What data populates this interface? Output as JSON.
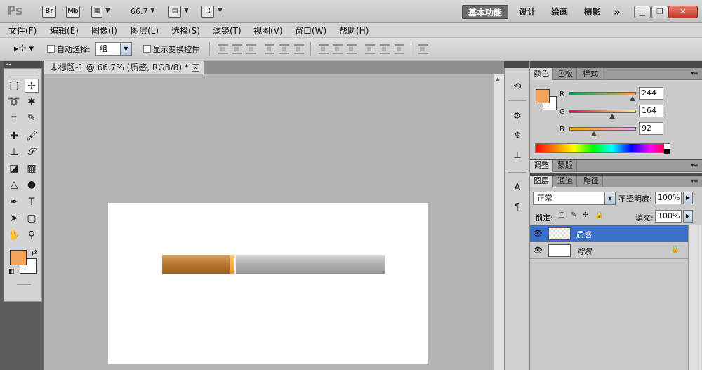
{
  "titlebar": {
    "logo": "Ps",
    "br": "Br",
    "mb": "Mb",
    "zoom": "66.7",
    "workspaces": [
      "基本功能",
      "设计",
      "绘画",
      "摄影"
    ],
    "more": "»"
  },
  "menu": [
    "文件(F)",
    "编辑(E)",
    "图像(I)",
    "图层(L)",
    "选择(S)",
    "滤镜(T)",
    "视图(V)",
    "窗口(W)",
    "帮助(H)"
  ],
  "options": {
    "auto_select_label": "自动选择:",
    "auto_select_value": "组",
    "show_transform_label": "显示变换控件"
  },
  "document": {
    "tab_title": "未标题-1 @ 66.7% (质感, RGB/8) *",
    "close": "×"
  },
  "colors": {
    "foreground": "#f4a45c",
    "background": "#ffffff",
    "selected_layer": "#3c6fc9"
  },
  "color_panel": {
    "tabs": [
      "颜色",
      "色板",
      "样式"
    ],
    "r_label": "R",
    "g_label": "G",
    "b_label": "B",
    "r": "244",
    "g": "164",
    "b": "92"
  },
  "adjust_panel": {
    "tabs": [
      "调整",
      "蒙版"
    ]
  },
  "layers_panel": {
    "tabs": [
      "图层",
      "通道",
      "路径"
    ],
    "blend_mode": "正常",
    "opacity_label": "不透明度:",
    "opacity": "100%",
    "lock_label": "锁定:",
    "fill_label": "填充:",
    "fill": "100%",
    "layers": [
      {
        "name": "质感"
      },
      {
        "name": "背景"
      }
    ]
  }
}
